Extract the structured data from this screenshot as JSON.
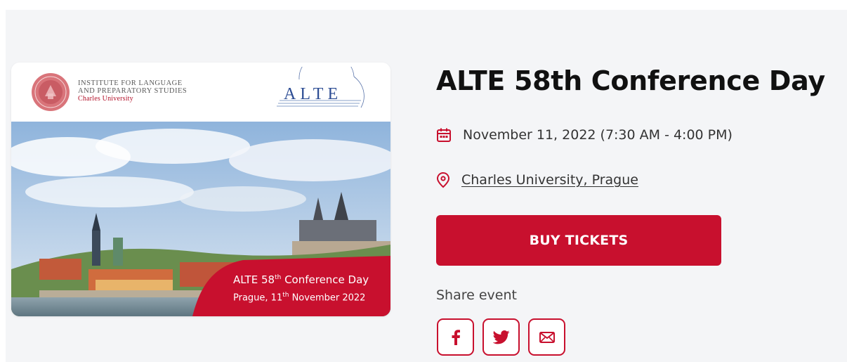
{
  "event": {
    "title": "ALTE 58th Conference Day",
    "date_text": "November 11, 2022 (7:30 AM - 4:00 PM)",
    "location_text": "Charles University, Prague",
    "buy_label": "BUY TICKETS",
    "share_label": "Share event"
  },
  "image": {
    "institute_line1": "INSTITUTE FOR LANGUAGE",
    "institute_line2": "AND PREPARATORY STUDIES",
    "institute_line3": "Charles University",
    "alte_logo_text": "ALTE",
    "caption_line1_prefix": "ALTE 58",
    "caption_line1_sup": "th",
    "caption_line1_suffix": " Conference Day",
    "caption_line2_prefix": "Prague, 11",
    "caption_line2_sup": "th",
    "caption_line2_suffix": " November 2022"
  },
  "icons": {
    "date": "calendar-icon",
    "location": "location-pin-icon",
    "share": [
      "facebook-icon",
      "twitter-icon",
      "email-icon"
    ]
  },
  "colors": {
    "accent": "#c8102e",
    "background": "#f4f5f7",
    "title": "#111111"
  }
}
